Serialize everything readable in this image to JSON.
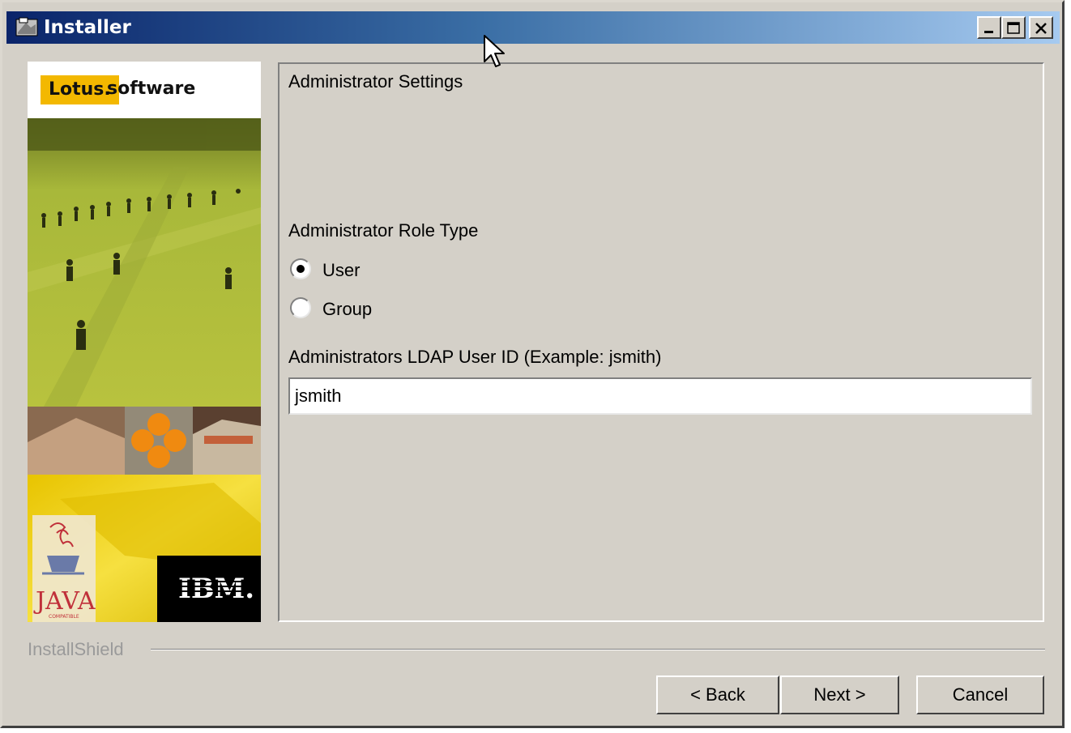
{
  "window": {
    "title": "Installer",
    "controls": [
      "minimize-icon",
      "maximize-icon",
      "close-icon"
    ],
    "title_gradient": [
      "#0a246a",
      "#a6caf0"
    ],
    "face_color": "#d4d0c8"
  },
  "sidebar": {
    "brand_lotus": "Lotus.",
    "brand_software": "software",
    "java_text": "JAVA",
    "java_sub": "COMPATIBLE",
    "ibm_text": "IBM."
  },
  "panel": {
    "title": "Administrator Settings",
    "role_label": "Administrator Role Type",
    "roles": [
      {
        "label": "User",
        "selected": true
      },
      {
        "label": "Group",
        "selected": false
      }
    ],
    "ldap_label": "Administrators LDAP User ID (Example: jsmith)",
    "ldap_value": "jsmith"
  },
  "footer": {
    "group_label": "InstallShield",
    "back_label": "< Back",
    "next_label": "Next >",
    "cancel_label": "Cancel"
  }
}
